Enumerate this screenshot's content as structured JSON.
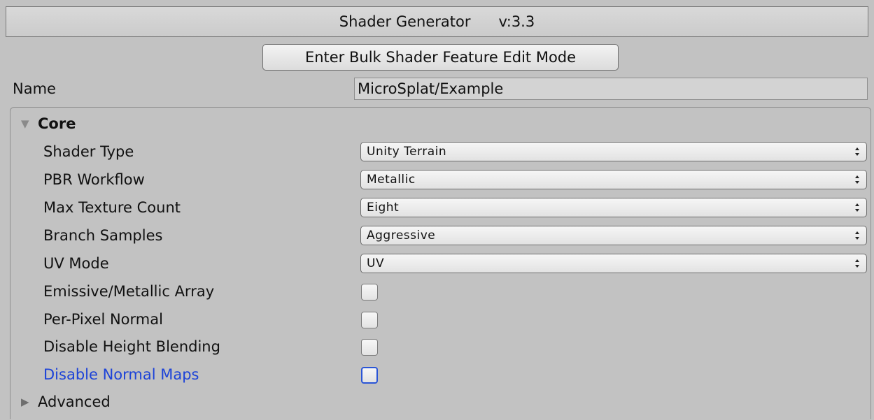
{
  "header": {
    "title": "Shader Generator",
    "version": "v:3.3"
  },
  "bulk_button_label": "Enter Bulk Shader Feature Edit Mode",
  "name_row": {
    "label": "Name",
    "value": "MicroSplat/Example"
  },
  "sections": {
    "core": {
      "label": "Core",
      "expanded": true
    },
    "advanced": {
      "label": "Advanced",
      "expanded": false
    }
  },
  "dropdowns": [
    {
      "label": "Shader Type",
      "value": "Unity Terrain"
    },
    {
      "label": "PBR Workflow",
      "value": "Metallic"
    },
    {
      "label": "Max Texture Count",
      "value": "Eight"
    },
    {
      "label": "Branch Samples",
      "value": "Aggressive"
    },
    {
      "label": "UV Mode",
      "value": "UV"
    }
  ],
  "toggles": [
    {
      "label": "Emissive/Metallic Array",
      "checked": false
    },
    {
      "label": "Per-Pixel Normal",
      "checked": false
    },
    {
      "label": "Disable Height Blending",
      "checked": false
    },
    {
      "label": "Disable Normal Maps",
      "checked": false,
      "focused": true
    }
  ],
  "colors": {
    "background": "#c2c2c2",
    "focused_label": "#1d43d8",
    "focus_ring": "#2a55d6"
  }
}
